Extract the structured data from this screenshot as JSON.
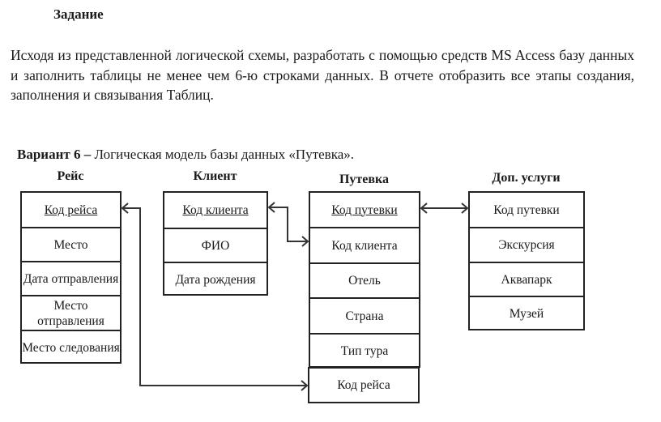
{
  "task": {
    "heading": "Задание",
    "paragraph": "Исходя из представленной логической схемы, разработать с помощью средств MS Access базу данных и заполнить таблицы не менее чем 6-ю строками данных. В отчете отобразить все этапы создания, заполнения и связывания Таблиц."
  },
  "caption": {
    "bold": "Вариант 6 –",
    "text": " Логическая модель базы данных «Путевка»."
  },
  "tables": {
    "reys": {
      "title": "Рейс",
      "fields": [
        "Код рейса",
        "Место",
        "Дата отправления",
        "Место отправления",
        "Место следования"
      ],
      "primary_key": "Код рейса"
    },
    "klient": {
      "title": "Клиент",
      "fields": [
        "Код клиента",
        "ФИО",
        "Дата рождения"
      ],
      "primary_key": "Код клиента"
    },
    "putevka": {
      "title": "Путевка",
      "fields": [
        "Код путевки",
        "Код клиента",
        "Отель",
        "Страна",
        "Тип тура",
        "Код рейса"
      ],
      "primary_key": "Код путевки"
    },
    "dop_uslugi": {
      "title": "Доп. услуги",
      "fields": [
        "Код путевки",
        "Экскурсия",
        "Аквапарк",
        "Музей"
      ]
    }
  },
  "relationships": [
    {
      "from": "Рейс.Код рейса",
      "to": "Путевка.Код рейса"
    },
    {
      "from": "Клиент.Код клиента",
      "to": "Путевка.Код клиента"
    },
    {
      "from": "Путевка.Код путевки",
      "to": "Доп. услуги.Код путевки"
    }
  ]
}
